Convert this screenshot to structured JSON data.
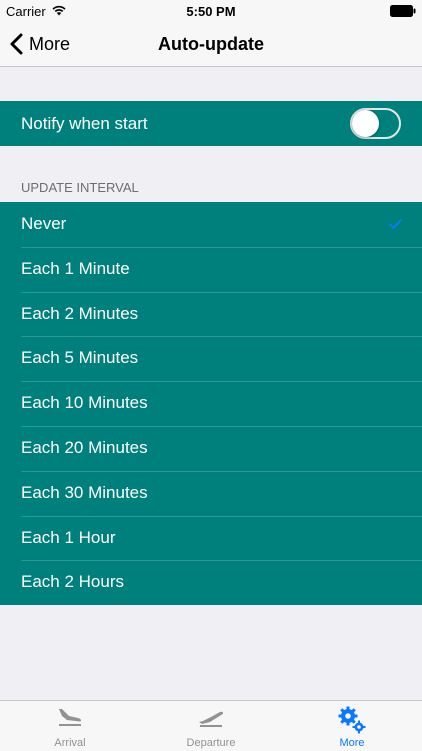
{
  "status_bar": {
    "carrier": "Carrier",
    "time": "5:50 PM"
  },
  "nav": {
    "back_label": "More",
    "title": "Auto-update"
  },
  "notify": {
    "label": "Notify when start",
    "enabled": false
  },
  "interval": {
    "header": "UPDATE INTERVAL",
    "options": [
      "Never",
      "Each 1 Minute",
      "Each 2 Minutes",
      "Each 5 Minutes",
      "Each 10 Minutes",
      "Each 20 Minutes",
      "Each 30 Minutes",
      "Each 1 Hour",
      "Each 2 Hours"
    ],
    "selected": "Never"
  },
  "tabs": [
    {
      "label": "Arrival",
      "icon": "plane-landing-icon",
      "active": false
    },
    {
      "label": "Departure",
      "icon": "plane-takeoff-icon",
      "active": false
    },
    {
      "label": "More",
      "icon": "gears-icon",
      "active": true
    }
  ],
  "colors": {
    "accent": "#00807c",
    "tint": "#0a79ff",
    "background": "#efeff4"
  }
}
